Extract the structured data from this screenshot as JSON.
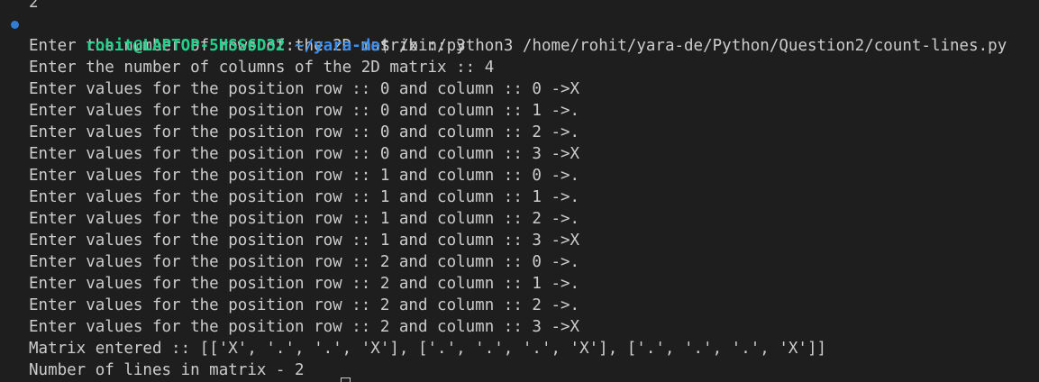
{
  "terminal": {
    "previous_output": "2",
    "prompt": {
      "user_host": "rohit@LAPTOP-5HSS6D32",
      "colon": ":",
      "path": "~/yara-de",
      "dollar": "$",
      "command": " /bin/python3 /home/rohit/yara-de/Python/Question2/count-lines.py"
    },
    "output_lines": [
      "Enter the number of rows of the 2D matrix :: 3",
      "Enter the number of columns of the 2D matrix :: 4",
      "Enter values for the position row :: 0 and column :: 0 ->X",
      "Enter values for the position row :: 0 and column :: 1 ->.",
      "Enter values for the position row :: 0 and column :: 2 ->.",
      "Enter values for the position row :: 0 and column :: 3 ->X",
      "Enter values for the position row :: 1 and column :: 0 ->.",
      "Enter values for the position row :: 1 and column :: 1 ->.",
      "Enter values for the position row :: 1 and column :: 2 ->.",
      "Enter values for the position row :: 1 and column :: 3 ->X",
      "Enter values for the position row :: 2 and column :: 0 ->.",
      "Enter values for the position row :: 2 and column :: 1 ->.",
      "Enter values for the position row :: 2 and column :: 2 ->.",
      "Enter values for the position row :: 2 and column :: 3 ->X",
      "Matrix entered :: [['X', '.', '.', 'X'], ['.', '.', '.', 'X'], ['.', '.', '.', 'X']]",
      "Number of lines in matrix - 2"
    ],
    "colors": {
      "background": "#1e1e1e",
      "text": "#cccccc",
      "user_host": "#23d18b",
      "path": "#3b8eea",
      "decoration_dot": "#3794ff"
    }
  }
}
